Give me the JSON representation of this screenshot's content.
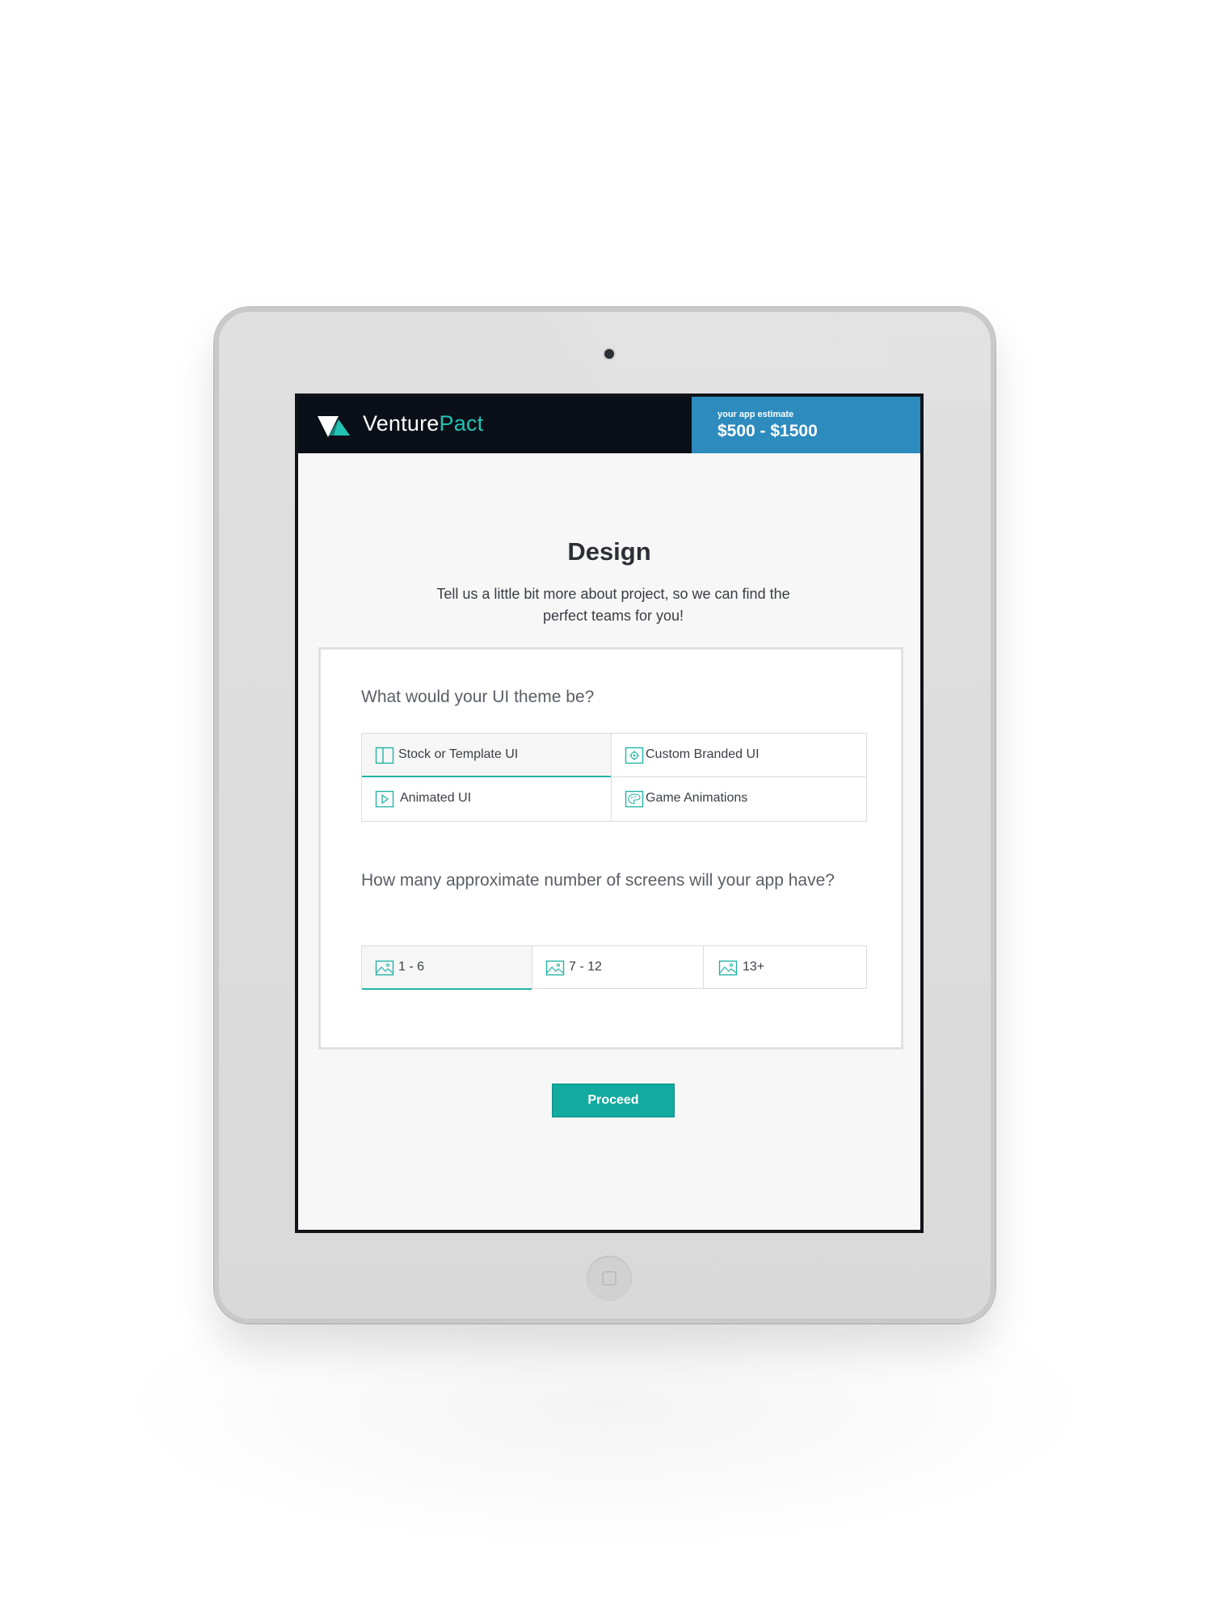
{
  "brand": {
    "name_primary": "Venture",
    "name_accent": "Pact",
    "accent_color": "#22c3b5",
    "bar_color": "#0b0f17"
  },
  "estimate": {
    "label": "your app estimate",
    "value": "$500 - $1500",
    "color": "#2d8bbd"
  },
  "page": {
    "title": "Design",
    "subtitle": "Tell us a little bit more about project, so we can find the perfect teams for you!"
  },
  "theme_question": {
    "text": "What would your UI theme be?",
    "options": [
      {
        "label": "Stock or Template UI",
        "icon": "layout-icon",
        "selected": true
      },
      {
        "label": "Custom Branded UI",
        "icon": "gear-icon",
        "selected": false
      },
      {
        "label": "Animated UI",
        "icon": "play-icon",
        "selected": false
      },
      {
        "label": "Game Animations",
        "icon": "palette-icon",
        "selected": false
      }
    ]
  },
  "screens_question": {
    "text": "How many approximate number of screens will your app have?",
    "options": [
      {
        "label": "1 - 6",
        "icon": "image-icon",
        "selected": true
      },
      {
        "label": "7 - 12",
        "icon": "image-icon",
        "selected": false
      },
      {
        "label": "13+",
        "icon": "image-icon",
        "selected": false
      }
    ]
  },
  "actions": {
    "proceed_label": "Proceed",
    "proceed_color": "#13aaa0"
  }
}
